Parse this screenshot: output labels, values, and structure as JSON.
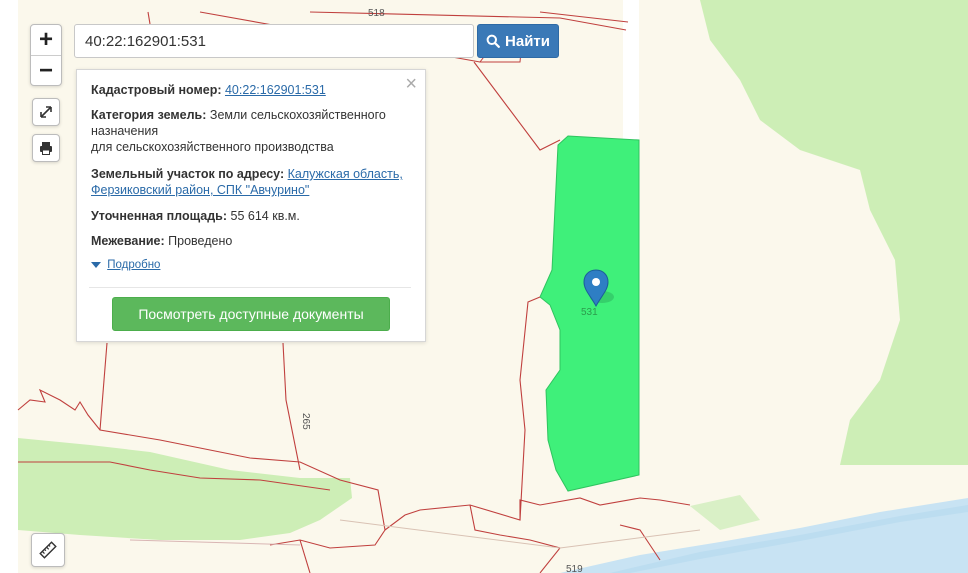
{
  "search": {
    "value": "40:22:162901:531",
    "button_label": "Найти"
  },
  "zoom": {
    "in_label": "+",
    "out_label": "−"
  },
  "map_labels": {
    "top": "518",
    "left_parcel": "265",
    "bottom": "519",
    "selected": "531"
  },
  "popup": {
    "cadastral_label": "Кадастровый номер:",
    "cadastral_value": "40:22:162901:531",
    "category_label": "Категория земель:",
    "category_value_line1": "Земли сельскохозяйственного",
    "category_value_line2": "назначения",
    "category_value_line3": "для сельскохозяйственного производства",
    "address_label": "Земельный участок по адресу:",
    "address_value_line1": "Калужская область,",
    "address_value_line2": "Ферзиковский район, СПК \"Авчурино\"",
    "area_label": "Уточненная площадь:",
    "area_value": "55 614 кв.м.",
    "survey_label": "Межевание:",
    "survey_value": "Проведено",
    "more_label": "Подробно",
    "docs_button": "Посмотреть доступные документы",
    "close_symbol": "×"
  },
  "colors": {
    "map_background": "#fbf8ec",
    "forest": "#cdeeb6",
    "selected_parcel": "#3ff07a",
    "parcel_border": "#c0403e",
    "water": "#c8e3f3",
    "search_button": "#3a79b7",
    "docs_button": "#5cb85c",
    "marker": "#2e7ec4"
  }
}
